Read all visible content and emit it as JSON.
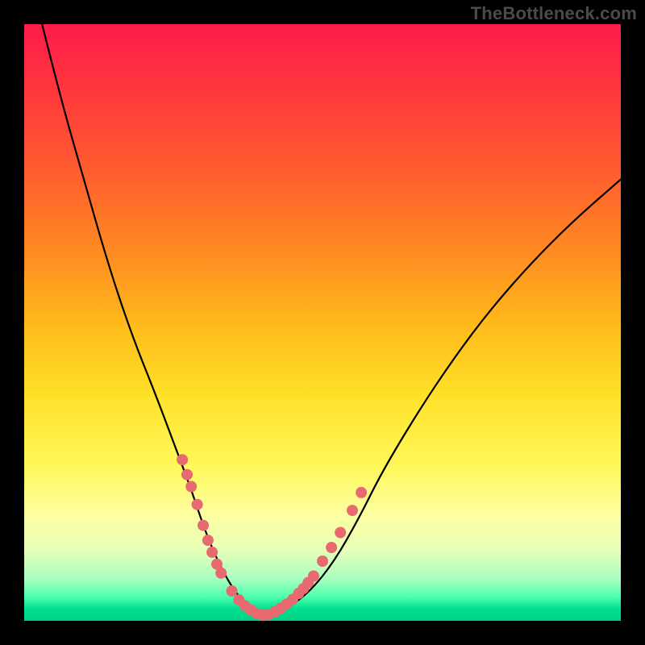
{
  "watermark": "TheBottleneck.com",
  "colors": {
    "curve": "#000000",
    "dot": "#e66a6f",
    "background_frame": "#000000"
  },
  "chart_data": {
    "type": "line",
    "title": "",
    "xlabel": "",
    "ylabel": "",
    "xlim": [
      0,
      100
    ],
    "ylim": [
      0,
      100
    ],
    "grid": false,
    "legend": false,
    "series": [
      {
        "name": "bottleneck_curve",
        "x": [
          3,
          6,
          10,
          14,
          18,
          22,
          25,
          28,
          30,
          32,
          34,
          36,
          38,
          40,
          44,
          48,
          52,
          56,
          60,
          66,
          72,
          78,
          85,
          92,
          100
        ],
        "y": [
          100,
          88,
          74,
          60,
          48,
          38,
          30,
          22,
          16,
          11,
          7,
          4,
          2,
          1,
          2,
          5,
          10,
          17,
          25,
          35,
          44,
          52,
          60,
          67,
          74
        ]
      }
    ],
    "highlight_points": {
      "name": "markers",
      "x": [
        26.5,
        27.3,
        28.0,
        29.0,
        30.0,
        30.8,
        31.5,
        32.3,
        33.0,
        34.8,
        36.0,
        37.0,
        38.0,
        39.0,
        40.0,
        41.0,
        42.0,
        43.0,
        44.0,
        45.0,
        46.0,
        46.8,
        47.6,
        48.5,
        50.0,
        51.5,
        53.0,
        55.0,
        56.5
      ],
      "y": [
        27.0,
        24.5,
        22.5,
        19.5,
        16.0,
        13.5,
        11.5,
        9.5,
        8.0,
        5.0,
        3.5,
        2.5,
        1.8,
        1.2,
        1.0,
        1.1,
        1.5,
        2.1,
        2.8,
        3.6,
        4.6,
        5.4,
        6.4,
        7.5,
        10.0,
        12.3,
        14.8,
        18.5,
        21.5
      ],
      "r": 7
    }
  }
}
